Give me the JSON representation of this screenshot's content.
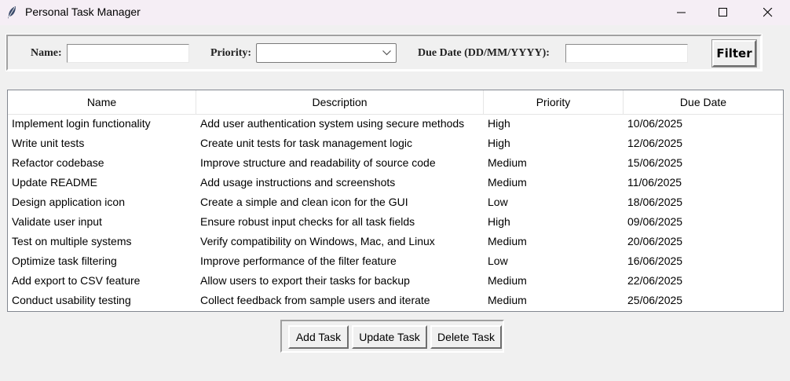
{
  "window": {
    "title": "Personal Task Manager"
  },
  "filters": {
    "name_label": "Name:",
    "name_value": "",
    "priority_label": "Priority:",
    "priority_value": "",
    "due_date_label": "Due Date (DD/MM/YYYY):",
    "due_date_value": "",
    "filter_button": "Filter"
  },
  "table": {
    "columns": [
      "Name",
      "Description",
      "Priority",
      "Due Date"
    ],
    "rows": [
      [
        "Implement login functionality",
        "Add user authentication system using secure methods",
        "High",
        "10/06/2025"
      ],
      [
        "Write unit tests",
        "Create unit tests for task management logic",
        "High",
        "12/06/2025"
      ],
      [
        "Refactor codebase",
        "Improve structure and readability of source code",
        "Medium",
        "15/06/2025"
      ],
      [
        "Update README",
        "Add usage instructions and screenshots",
        "Medium",
        "11/06/2025"
      ],
      [
        "Design application icon",
        "Create a simple and clean icon for the GUI",
        "Low",
        "18/06/2025"
      ],
      [
        "Validate user input",
        "Ensure robust input checks for all task fields",
        "High",
        "09/06/2025"
      ],
      [
        "Test on multiple systems",
        "Verify compatibility on Windows, Mac, and Linux",
        "Medium",
        "20/06/2025"
      ],
      [
        "Optimize task filtering",
        "Improve performance of the filter feature",
        "Low",
        "16/06/2025"
      ],
      [
        "Add export to CSV feature",
        "Allow users to export their tasks for backup",
        "Medium",
        "22/06/2025"
      ],
      [
        "Conduct usability testing",
        "Collect feedback from sample users and iterate",
        "Medium",
        "25/06/2025"
      ]
    ]
  },
  "actions": {
    "add": "Add Task",
    "update": "Update Task",
    "delete": "Delete Task"
  },
  "icons": {
    "app": "feather-icon",
    "minimize": "minimize-icon",
    "maximize": "maximize-icon",
    "close": "close-icon",
    "dropdown": "chevron-down-icon"
  }
}
